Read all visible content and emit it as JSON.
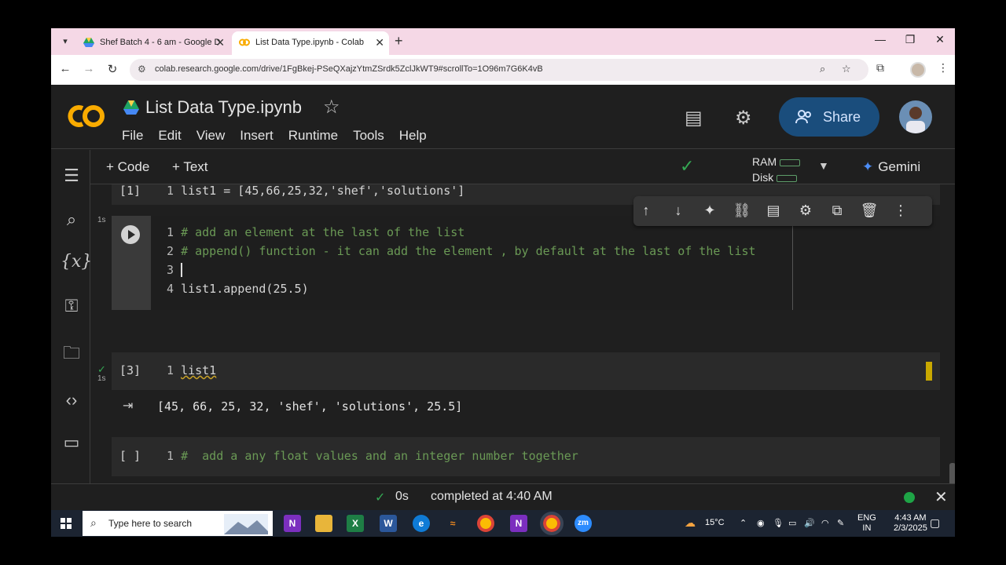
{
  "browser": {
    "tabs": [
      {
        "title": "Shef Batch 4 - 6 am - Google D",
        "active": false
      },
      {
        "title": "List Data Type.ipynb - Colab",
        "active": true
      }
    ],
    "url": "colab.research.google.com/drive/1FgBkej-PSeQXajzYtmZSrdk5ZclJkWT9#scrollTo=1O96m7G6K4vB"
  },
  "colab": {
    "logo_text": "CO",
    "notebook_title": "List Data Type.ipynb",
    "menu": [
      "File",
      "Edit",
      "View",
      "Insert",
      "Runtime",
      "Tools",
      "Help"
    ],
    "share_label": "Share",
    "toolbar": {
      "add_code": "+ Code",
      "add_text": "+ Text",
      "ram_label": "RAM",
      "disk_label": "Disk",
      "gemini_label": "Gemini"
    },
    "cells": [
      {
        "exec": "[1]",
        "time": "1s",
        "lines": [
          {
            "n": "1",
            "code": "list1 = [45,66,25,32,'shef','solutions']"
          }
        ]
      },
      {
        "exec": "",
        "lines": [
          {
            "n": "1",
            "code": "# add an element at the last of the list"
          },
          {
            "n": "2",
            "code": "# append() function - it can add the element , by default at the last of the list"
          },
          {
            "n": "3",
            "code": ""
          },
          {
            "n": "4",
            "code": "list1.append(25.5)"
          }
        ]
      },
      {
        "exec": "[3]",
        "time": "1s",
        "lines": [
          {
            "n": "1",
            "code": "list1"
          }
        ],
        "output": "[45, 66, 25, 32, 'shef', 'solutions', 25.5]"
      },
      {
        "exec": "[ ]",
        "lines": [
          {
            "n": "1",
            "code": "#  add a any float values and an integer number together"
          }
        ]
      }
    ],
    "status": {
      "duration": "0s",
      "message": "completed at 4:40 AM"
    }
  },
  "taskbar": {
    "search_placeholder": "Type here to search",
    "weather": "15°C",
    "lang": "ENG",
    "region": "IN",
    "time": "4:43 AM",
    "date": "2/3/2025"
  },
  "colors": {
    "accent": "#1a4d7c",
    "comment": "#6a9955",
    "logo_orange": "#f9ab00",
    "success": "#34a853"
  }
}
